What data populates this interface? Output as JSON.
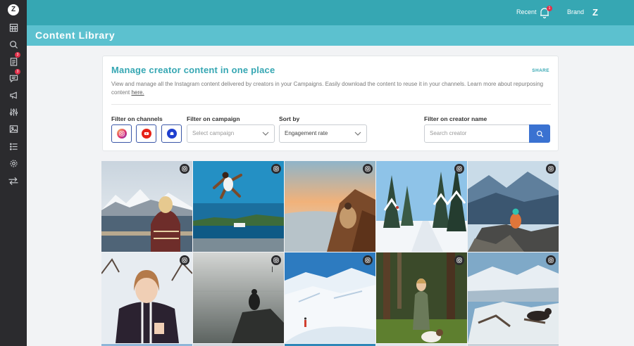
{
  "sidebar": {
    "logo": "Z",
    "items": [
      {
        "icon": "grid-icon",
        "badge": ""
      },
      {
        "icon": "search-icon",
        "badge": ""
      },
      {
        "icon": "clipboard-icon",
        "badge": "3"
      },
      {
        "icon": "chat-icon",
        "badge": "3"
      },
      {
        "icon": "megaphone-icon",
        "badge": ""
      },
      {
        "icon": "sliders-icon",
        "badge": ""
      },
      {
        "icon": "image-icon",
        "badge": ""
      },
      {
        "icon": "list-icon",
        "badge": ""
      },
      {
        "icon": "gear-icon",
        "badge": ""
      },
      {
        "icon": "swap-icon",
        "badge": ""
      }
    ]
  },
  "header": {
    "recent_label": "Recent",
    "notification_count": "1",
    "brand_label": "Brand",
    "brand_logo": "Z"
  },
  "page": {
    "title": "Content Library"
  },
  "card": {
    "heading": "Manage creator content in one place",
    "share_label": "SHARE",
    "description": "View and manage all the Instagram content delivered by creators in your Campaigns. Easily download the content to reuse it in your channels. Learn more about repurposing content ",
    "link_text": "here."
  },
  "filters": {
    "channels_label": "Filter on channels",
    "channels": [
      {
        "icon": "instagram-icon",
        "color": "#e1306c"
      },
      {
        "icon": "youtube-icon",
        "color": "#e62117"
      },
      {
        "icon": "blog-icon",
        "color": "#1f3fcf"
      }
    ],
    "campaign_label": "Filter on campaign",
    "campaign_placeholder": "Select campaign",
    "sort_label": "Sort by",
    "sort_value": "Engagement rate",
    "creator_label": "Filter on creator name",
    "creator_placeholder": "Search creator"
  },
  "colors": {
    "accent": "#36a7b3",
    "accent_light": "#5cc1cf",
    "sidebar": "#2b2b2e",
    "primary_button": "#3a72d1",
    "badge": "#e0304a"
  },
  "content_tiles": [
    {
      "platform": "instagram-icon",
      "scene": "woman-by-fjord"
    },
    {
      "platform": "instagram-icon",
      "scene": "woman-jumping-by-sea"
    },
    {
      "platform": "instagram-icon",
      "scene": "hiker-sunset-cliff"
    },
    {
      "platform": "instagram-icon",
      "scene": "snowy-forest-trail"
    },
    {
      "platform": "instagram-icon",
      "scene": "hiker-mountain-view"
    },
    {
      "platform": "instagram-icon",
      "scene": "smiling-woman-snow"
    },
    {
      "platform": "instagram-icon",
      "scene": "person-on-rock-lake"
    },
    {
      "platform": "instagram-icon",
      "scene": "snowy-mountains-skier"
    },
    {
      "platform": "instagram-icon",
      "scene": "woman-in-forest-with-dog"
    },
    {
      "platform": "instagram-icon",
      "scene": "dog-on-snowy-peak"
    }
  ]
}
